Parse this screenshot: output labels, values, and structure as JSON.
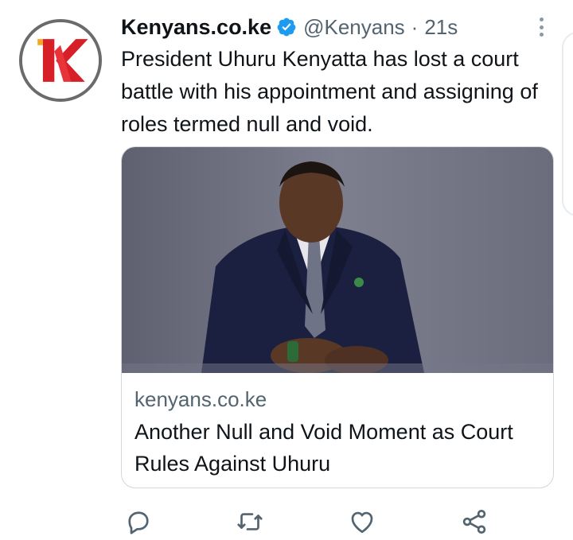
{
  "tweet": {
    "display_name": "Kenyans.co.ke",
    "handle": "@Kenyans",
    "separator": "·",
    "time": "21s",
    "text": "President Uhuru Kenyatta has lost a court battle with his appointment and assigning of roles termed null and void.",
    "avatar_icon": "kenyans-logo-icon",
    "verified_icon": "verified-badge-icon",
    "more_icon": "more-options-icon"
  },
  "card": {
    "image_icon": "article-photo",
    "domain": "kenyans.co.ke",
    "title": "Another Null and Void Moment as Court Rules Against Uhuru"
  },
  "actions": [
    {
      "name": "reply",
      "icon": "reply-icon"
    },
    {
      "name": "retweet",
      "icon": "retweet-icon"
    },
    {
      "name": "like",
      "icon": "heart-icon"
    },
    {
      "name": "share",
      "icon": "share-icon"
    }
  ],
  "colors": {
    "text": "#0f1419",
    "secondary": "#536471",
    "verified": "#1d9bf0",
    "logo_red": "#d61f26",
    "logo_orange": "#f5a623",
    "border": "#cfd9de"
  }
}
